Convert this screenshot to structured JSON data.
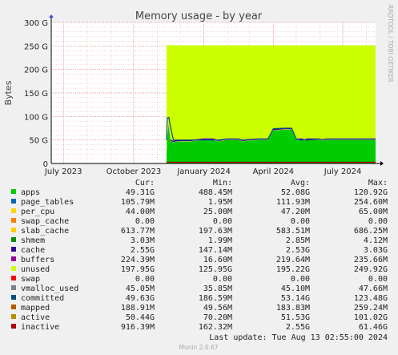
{
  "chart_data": {
    "type": "area",
    "title": "Memory usage - by year",
    "ylabel": "Bytes",
    "ylim": [
      0,
      300
    ],
    "y_unit": "G",
    "yticks": [
      "0",
      "50 G",
      "100 G",
      "150 G",
      "200 G",
      "250 G",
      "300 G"
    ],
    "yticks_values": [
      0,
      50,
      100,
      150,
      200,
      250,
      300
    ],
    "xlim": [
      "2023-06-15",
      "2024-08-13"
    ],
    "xticks": [
      {
        "label": "July 2023",
        "date": "2023-07-01"
      },
      {
        "label": "October 2023",
        "date": "2023-10-01"
      },
      {
        "label": "January 2024",
        "date": "2024-01-01"
      },
      {
        "label": "April 2024",
        "date": "2024-04-01"
      },
      {
        "label": "July 2024",
        "date": "2024-07-01"
      }
    ],
    "grid": true,
    "side_label": "RRDTOOL / TOBI OETIKER",
    "x": [
      "2023-11-13",
      "2023-11-14",
      "2023-11-16",
      "2023-11-18",
      "2023-11-22",
      "2023-11-25",
      "2023-12-01",
      "2023-12-15",
      "2024-01-01",
      "2024-01-12",
      "2024-01-20",
      "2024-02-01",
      "2024-02-15",
      "2024-02-20",
      "2024-03-10",
      "2024-03-25",
      "2024-04-01",
      "2024-04-15",
      "2024-04-25",
      "2024-05-01",
      "2024-05-08",
      "2024-05-12",
      "2024-05-15",
      "2024-06-01",
      "2024-06-03",
      "2024-06-10",
      "2024-06-20",
      "2024-07-01",
      "2024-07-15",
      "2024-08-13"
    ],
    "series": [
      {
        "name": "apps",
        "color": "#00cc00",
        "values": [
          18,
          55,
          80,
          48,
          45,
          46,
          47,
          47,
          50,
          50,
          47,
          50,
          50,
          47,
          50,
          50,
          70,
          72,
          72,
          50,
          50,
          48,
          50,
          50,
          48,
          50,
          50,
          50,
          50,
          50
        ]
      },
      {
        "name": "page_tables",
        "color": "#0066b3",
        "values": [
          0.1,
          0.1,
          0.1,
          0.1,
          0.1,
          0.1,
          0.1,
          0.1,
          0.1,
          0.1,
          0.1,
          0.1,
          0.1,
          0.1,
          0.1,
          0.1,
          0.1,
          0.1,
          0.1,
          0.1,
          0.1,
          0.1,
          0.1,
          0.1,
          0.1,
          0.1,
          0.1,
          0.1,
          0.1,
          0.1
        ]
      },
      {
        "name": "per_cpu",
        "color": "#ffd700",
        "values": [
          0.04,
          0.04,
          0.04,
          0.04,
          0.04,
          0.04,
          0.04,
          0.04,
          0.04,
          0.04,
          0.04,
          0.04,
          0.04,
          0.04,
          0.04,
          0.04,
          0.04,
          0.04,
          0.04,
          0.04,
          0.04,
          0.04,
          0.04,
          0.04,
          0.04,
          0.04,
          0.04,
          0.04,
          0.04,
          0.04
        ]
      },
      {
        "name": "swap_cache",
        "color": "#ff8000",
        "values": [
          0,
          0,
          0,
          0,
          0,
          0,
          0,
          0,
          0,
          0,
          0,
          0,
          0,
          0,
          0,
          0,
          0,
          0,
          0,
          0,
          0,
          0,
          0,
          0,
          0,
          0,
          0,
          0,
          0,
          0
        ]
      },
      {
        "name": "slab_cache",
        "color": "#ffcc00",
        "values": [
          0.6,
          0.6,
          0.6,
          0.6,
          0.6,
          0.6,
          0.6,
          0.6,
          0.6,
          0.6,
          0.6,
          0.6,
          0.6,
          0.6,
          0.6,
          0.6,
          0.6,
          0.6,
          0.6,
          0.6,
          0.6,
          0.6,
          0.6,
          0.6,
          0.6,
          0.6,
          0.6,
          0.6,
          0.6,
          0.6
        ]
      },
      {
        "name": "shmem",
        "color": "#008f00",
        "values": [
          0,
          0,
          0,
          0,
          0,
          0,
          0,
          0,
          0,
          0,
          0,
          0,
          0,
          0,
          0,
          0,
          0,
          0,
          0,
          0,
          0,
          0,
          0,
          0,
          0,
          0,
          0,
          0,
          0,
          0
        ]
      },
      {
        "name": "cache",
        "color": "#330099",
        "values": [
          2,
          3,
          3,
          2.5,
          2.5,
          2.5,
          2.5,
          2.5,
          2.5,
          2.5,
          2.5,
          2.5,
          2.5,
          2.5,
          2.5,
          2.5,
          2.5,
          2.5,
          2.5,
          2.5,
          2.5,
          2.5,
          2.5,
          2.5,
          2.5,
          2.5,
          2.5,
          2.5,
          2.5,
          2.5
        ]
      },
      {
        "name": "buffers",
        "color": "#990099",
        "values": [
          0.2,
          0.2,
          0.2,
          0.2,
          0.2,
          0.2,
          0.2,
          0.2,
          0.2,
          0.2,
          0.2,
          0.2,
          0.2,
          0.2,
          0.2,
          0.2,
          0.2,
          0.2,
          0.2,
          0.2,
          0.2,
          0.2,
          0.2,
          0.2,
          0.2,
          0.2,
          0.2,
          0.2,
          0.2,
          0.2
        ]
      },
      {
        "name": "unused",
        "color": "#ccff00",
        "values": [
          231,
          193,
          168,
          200,
          203,
          202,
          201,
          201,
          198,
          198,
          201,
          198,
          198,
          201,
          198,
          198,
          178,
          176,
          176,
          198,
          198,
          200,
          198,
          198,
          200,
          198,
          198,
          198,
          198,
          198
        ]
      },
      {
        "name": "swap",
        "color": "#ff0000",
        "values": [
          0,
          0,
          0,
          0,
          0,
          0,
          0,
          0,
          0,
          0,
          0,
          0,
          0,
          0,
          0,
          0,
          0,
          0,
          0,
          0,
          0,
          0,
          0,
          0,
          0,
          0,
          0,
          0,
          0,
          0
        ]
      }
    ],
    "line_series": [
      {
        "name": "committed",
        "color": "#004d80",
        "values": [
          50,
          97,
          98,
          80,
          50,
          50,
          50,
          50,
          50,
          50,
          50,
          52,
          52,
          50,
          52,
          52,
          74,
          75,
          75,
          52,
          50,
          50,
          50,
          52,
          50,
          52,
          52,
          52,
          52,
          52
        ]
      },
      {
        "name": "inactive",
        "color": "#b30000",
        "values": [
          2,
          3,
          3,
          2.5,
          2.5,
          2.5,
          2.5,
          2.5,
          2.5,
          2.5,
          2.5,
          2.5,
          2.5,
          2.5,
          2.5,
          2.5,
          2.5,
          2.5,
          2.5,
          2.5,
          2.5,
          2.5,
          2.5,
          2.5,
          2.5,
          2.5,
          2.5,
          2.5,
          2.5,
          2.5
        ]
      }
    ]
  },
  "legend": {
    "headers": {
      "cur": "Cur:",
      "min": "Min:",
      "avg": "Avg:",
      "max": "Max:"
    },
    "rows": [
      {
        "name": "apps",
        "color": "#00cc00",
        "cur": "49.31G",
        "min": "488.45M",
        "avg": "52.08G",
        "max": "120.92G"
      },
      {
        "name": "page_tables",
        "color": "#0066b3",
        "cur": "105.79M",
        "min": "1.95M",
        "avg": "111.93M",
        "max": "254.60M"
      },
      {
        "name": "per_cpu",
        "color": "#ffd700",
        "cur": "44.00M",
        "min": "25.00M",
        "avg": "47.20M",
        "max": "65.00M"
      },
      {
        "name": "swap_cache",
        "color": "#ff8000",
        "cur": "0.00",
        "min": "0.00",
        "avg": "0.00",
        "max": "0.00"
      },
      {
        "name": "slab_cache",
        "color": "#ffcc00",
        "cur": "613.77M",
        "min": "197.63M",
        "avg": "583.51M",
        "max": "686.25M"
      },
      {
        "name": "shmem",
        "color": "#008f00",
        "cur": "3.03M",
        "min": "1.99M",
        "avg": "2.85M",
        "max": "4.12M"
      },
      {
        "name": "cache",
        "color": "#330099",
        "cur": "2.55G",
        "min": "147.14M",
        "avg": "2.53G",
        "max": "3.03G"
      },
      {
        "name": "buffers",
        "color": "#990099",
        "cur": "224.39M",
        "min": "16.60M",
        "avg": "219.64M",
        "max": "235.66M"
      },
      {
        "name": "unused",
        "color": "#ccff00",
        "cur": "197.95G",
        "min": "125.95G",
        "avg": "195.22G",
        "max": "249.92G"
      },
      {
        "name": "swap",
        "color": "#ff0000",
        "cur": "0.00",
        "min": "0.00",
        "avg": "0.00",
        "max": "0.00"
      },
      {
        "name": "vmalloc_used",
        "color": "#808080",
        "cur": "45.05M",
        "min": "35.85M",
        "avg": "45.10M",
        "max": "47.66M"
      },
      {
        "name": "committed",
        "color": "#004d80",
        "cur": "49.63G",
        "min": "186.59M",
        "avg": "53.14G",
        "max": "123.48G"
      },
      {
        "name": "mapped",
        "color": "#b35a00",
        "cur": "188.91M",
        "min": "49.56M",
        "avg": "183.83M",
        "max": "259.24M"
      },
      {
        "name": "active",
        "color": "#b38f00",
        "cur": "50.44G",
        "min": "70.20M",
        "avg": "51.53G",
        "max": "101.02G"
      },
      {
        "name": "inactive",
        "color": "#b30000",
        "cur": "916.39M",
        "min": "162.32M",
        "avg": "2.55G",
        "max": "61.46G"
      }
    ]
  },
  "footer": {
    "last_update": "Last update: Tue Aug 13 02:55:00 2024",
    "version": "Munin 2.0.67"
  }
}
